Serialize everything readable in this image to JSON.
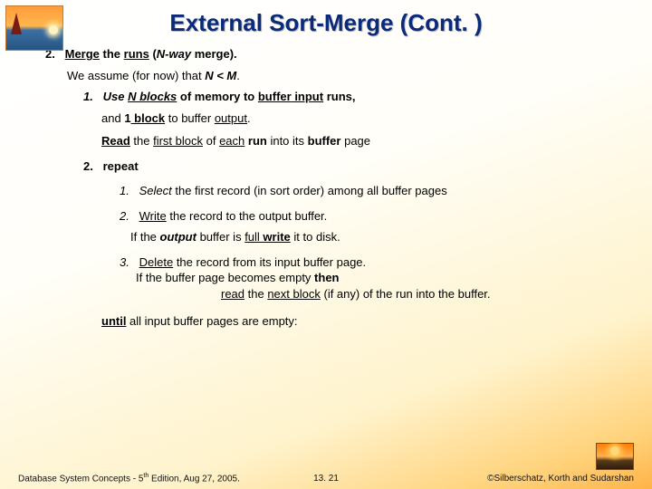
{
  "title": "External Sort-Merge (Cont. )",
  "step2": {
    "num": "2.",
    "merge_label": "Merge",
    "the": " the ",
    "runs": "runs",
    "open_paren": " (",
    "nway": "N-way",
    "rest": " merge)."
  },
  "assume": {
    "prefix": "We assume (for now) that ",
    "nltm": "N < M",
    "dot": "."
  },
  "sub1": {
    "num": "1.",
    "use": "Use ",
    "nblocks": "N blocks",
    "ofmem": " of memory to ",
    "buffer": "buffer",
    "input": " input",
    "runs": " runs,",
    "and": "and ",
    "one": "1",
    "block": " block",
    "tobuf": " to buffer ",
    "output": "output",
    "dot": ".",
    "read": "Read",
    "the_first": " the ",
    "first_block": "first block",
    "of": " of ",
    "each": "each",
    "run": " run",
    "into": " into its ",
    "bufferw": "buffer",
    "page": " page"
  },
  "sub2": {
    "num": "2.",
    "repeat": "repeat",
    "r1_num": "1.",
    "r1_select": "Select",
    "r1_rest": " the first record (in sort order) among all buffer pages",
    "r2_num": "2.",
    "r2_write": "Write",
    "r2_rest": " the record to the output buffer.",
    "r2_if1": "If the ",
    "r2_output": "output",
    "r2_if2": " buffer is ",
    "r2_full": "full",
    "r2_writeb": " write",
    "r2_if3": " it to disk.",
    "r3_num": "3.",
    "r3_delete": "Delete",
    "r3_rest": " the record from its input buffer page.",
    "r3_if1": "If the buffer page becomes empty ",
    "r3_then": "then",
    "r3_read": "read",
    "r3_the": " the ",
    "r3_next": "next block",
    "r3_rest2": " (if any) of the run into the buffer.",
    "until": "until",
    "until_rest": " all input buffer pages are empty:"
  },
  "footer": {
    "left_a": "Database System Concepts - 5",
    "left_th": "th",
    "left_b": " Edition, Aug 27,  2005.",
    "center": "13. 21",
    "right": "©Silberschatz, Korth and Sudarshan"
  }
}
